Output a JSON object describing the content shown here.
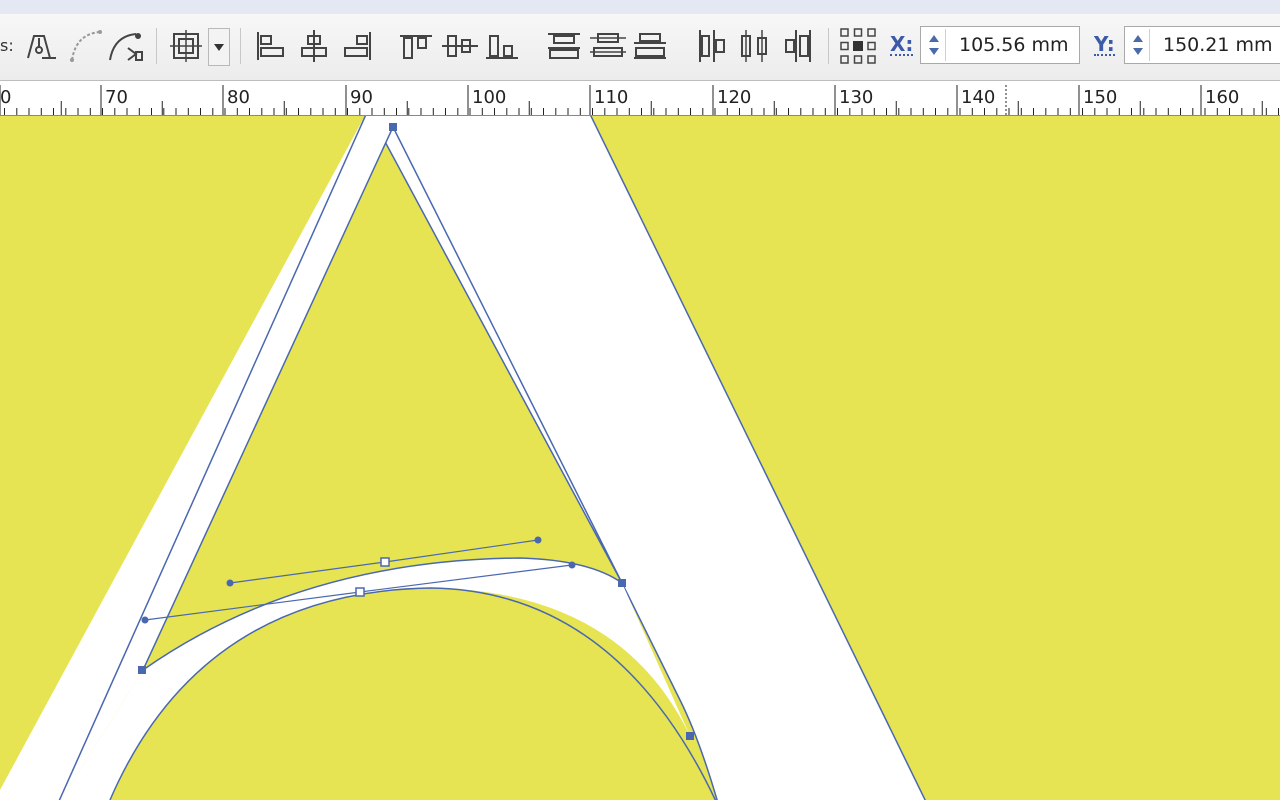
{
  "toolbar": {
    "cut_label": "s:",
    "tools": [
      {
        "name": "node-tool-icon"
      },
      {
        "name": "curve-tool-icon"
      },
      {
        "name": "smart-curve-icon"
      },
      {
        "name": "group-box-icon"
      },
      {
        "name": "align-left-icon"
      },
      {
        "name": "align-center-horizontal-icon"
      },
      {
        "name": "align-right-icon"
      },
      {
        "name": "align-top-icon"
      },
      {
        "name": "align-middle-vertical-icon"
      },
      {
        "name": "align-bottom-icon"
      },
      {
        "name": "distribute-top-icon"
      },
      {
        "name": "distribute-center-icon"
      },
      {
        "name": "distribute-bottom-icon"
      },
      {
        "name": "distribute-left-icon"
      },
      {
        "name": "distribute-horizontal-icon"
      },
      {
        "name": "distribute-right-icon"
      },
      {
        "name": "reference-point-icon"
      }
    ],
    "x_label": "X:",
    "x_value": "105.56 mm",
    "y_label": "Y:",
    "y_value": "150.21 mm"
  },
  "ruler": {
    "labels": [
      "0",
      "70",
      "80",
      "90",
      "100",
      "110",
      "120",
      "130",
      "140",
      "150",
      "160"
    ]
  },
  "colors": {
    "background": "#e6e452",
    "glyph_fill": "#ffffff",
    "path_stroke": "#4a68b0",
    "node": "#4a68b0"
  }
}
